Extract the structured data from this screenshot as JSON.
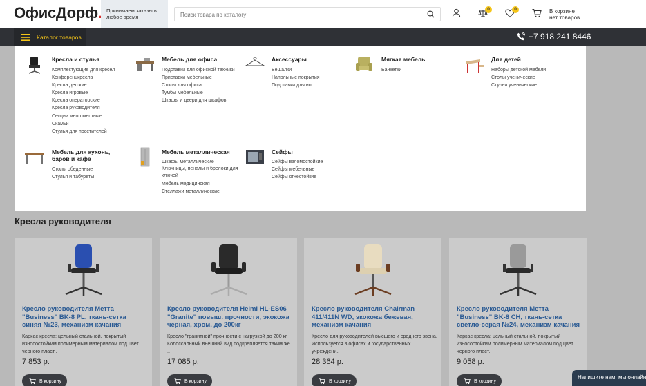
{
  "header": {
    "logo_main": "ОфисДорф",
    "logo_dot": ".",
    "notice": "Принимаем заказы в любое время",
    "search_placeholder": "Поиск товара по каталогу",
    "compare_count": "0",
    "favorites_count": "0",
    "cart_line1": "В корзине",
    "cart_line2": "нет товаров"
  },
  "nav": {
    "catalog_label": "Каталог товаров",
    "phone": "+7 918 241 8446"
  },
  "menu": [
    {
      "title": "Кресла и стулья",
      "icon": "office-chair-icon",
      "links": [
        "Комплектующие для кресел",
        "Конференцкресла",
        "Кресла детские",
        "Кресла игровые",
        "Кресла операторские",
        "Кресла руководителя",
        "Секции многоместные",
        "Скамьи",
        "Стулья для посетителей"
      ]
    },
    {
      "title": "Мебель для офиса",
      "icon": "office-desk-icon",
      "links": [
        "Подставки для офисной техники",
        "Приставки мебельные",
        "Столы для офиса",
        "Тумбы мебельные",
        "Шкафы и двери для шкафов"
      ]
    },
    {
      "title": "Аксессуары",
      "icon": "hanger-icon",
      "links": [
        "Вешалки",
        "Напольные покрытия",
        "Подставки для ног"
      ]
    },
    {
      "title": "Мягкая мебель",
      "icon": "armchair-icon",
      "links": [
        "Банкетки"
      ]
    },
    {
      "title": "Для детей",
      "icon": "kids-desk-icon",
      "links": [
        "Наборы детской мебели",
        "Столы ученические",
        "Стулья ученические."
      ]
    },
    {
      "title": "Мебель для кухонь, баров и кафе",
      "icon": "table-icon",
      "links": [
        "Столы обеденные",
        "Стулья и табуреты"
      ]
    },
    {
      "title": "Мебель металлическая",
      "icon": "metal-cabinet-icon",
      "links": [
        "Шкафы металлические",
        "Ключницы, пеналы и брелоки для ключей",
        "Мебель медицинская",
        "Стеллажи металлические"
      ]
    },
    {
      "title": "Сейфы",
      "icon": "safe-icon",
      "links": [
        "Сейфы взломостойкие",
        "Сейфы мебельные",
        "Сейфы огнестойкие"
      ]
    }
  ],
  "section_title": "Кресла руководителя",
  "products": [
    {
      "title": "Кресло руководителя Метта \"Business\" BK-8 PL, ткань-сетка синяя №23, механизм качания",
      "desc": "Каркас кресла: цельный стальной, покрытый износостойким полимерным материалом под цвет черного пласт..",
      "price": "7 853 р.",
      "cart_label": "В корзину",
      "color": "#2a4fb0"
    },
    {
      "title": "Кресло руководителя Helmi HL-ES06 \"Granite\" повыш. прочности, экокожа черная, хром, до 200кг",
      "desc": "Кресло \"гранитной\" прочности с нагрузкой до 200 кг. Колоссальный внешний вид подкрепляется таким же ..",
      "price": "17 085 р.",
      "cart_label": "В корзину",
      "color": "#2a2a2a"
    },
    {
      "title": "Кресло руководителя Chairman 411/411N WD, экокожа бежевая, механизм качания",
      "desc": "Кресло для руководителей высшего и среднего звена. Используется в офисах и государственных учреждени..",
      "price": "28 364 р.",
      "cart_label": "В корзину",
      "color": "#e8dcc0"
    },
    {
      "title": "Кресло руководителя Метта \"Business\" BK-8 CH, ткань-сетка светло-серая №24, механизм качания",
      "desc": "Каркас кресла: цельный стальной, покрытый износостойким полимерным материалом под цвет черного пласт..",
      "price": "9 058 р.",
      "cart_label": "В корзину",
      "color": "#9a9a9a"
    }
  ],
  "chat_label": "Напишите нам, мы онлайн!"
}
